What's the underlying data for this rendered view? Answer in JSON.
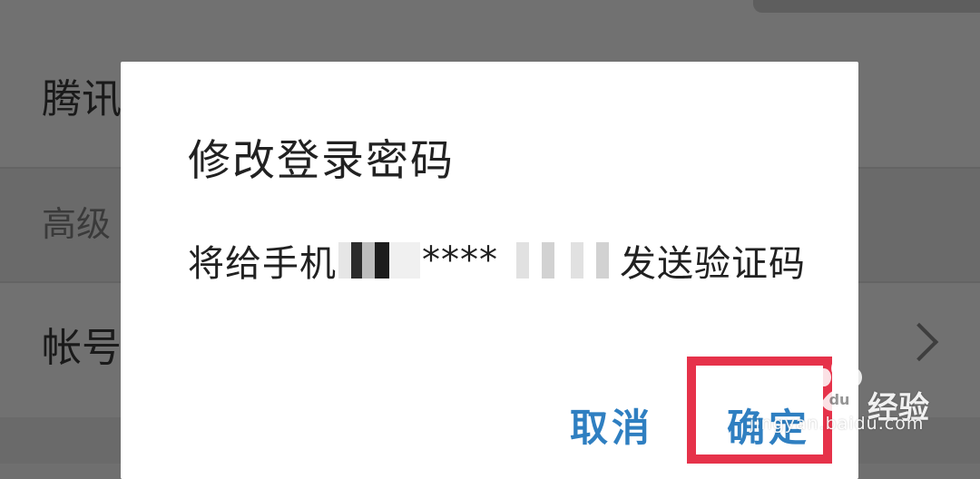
{
  "background": {
    "row1_label": "腾讯",
    "row2_label": "高级",
    "row3_label": "帐号"
  },
  "dialog": {
    "title": "修改登录密码",
    "message_prefix": "将给手机",
    "message_masked": "****",
    "message_suffix": "发送验证码",
    "cancel_label": "取消",
    "confirm_label": "确定"
  },
  "watermark": {
    "brand_text": "经验",
    "url": "jingyan.baidu.com"
  },
  "colors": {
    "accent": "#2f7fc1",
    "highlight": "#e6324a",
    "overlay": "#717171"
  }
}
